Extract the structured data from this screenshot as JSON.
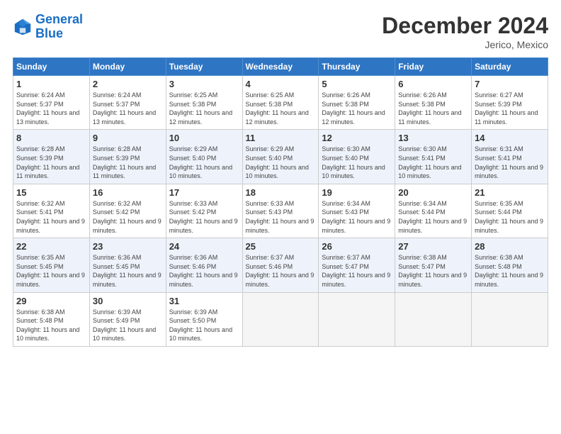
{
  "header": {
    "logo_line1": "General",
    "logo_line2": "Blue",
    "title": "December 2024",
    "subtitle": "Jerico, Mexico"
  },
  "days_of_week": [
    "Sunday",
    "Monday",
    "Tuesday",
    "Wednesday",
    "Thursday",
    "Friday",
    "Saturday"
  ],
  "weeks": [
    [
      {
        "day": "1",
        "sunrise": "Sunrise: 6:24 AM",
        "sunset": "Sunset: 5:37 PM",
        "daylight": "Daylight: 11 hours and 13 minutes."
      },
      {
        "day": "2",
        "sunrise": "Sunrise: 6:24 AM",
        "sunset": "Sunset: 5:37 PM",
        "daylight": "Daylight: 11 hours and 13 minutes."
      },
      {
        "day": "3",
        "sunrise": "Sunrise: 6:25 AM",
        "sunset": "Sunset: 5:38 PM",
        "daylight": "Daylight: 11 hours and 12 minutes."
      },
      {
        "day": "4",
        "sunrise": "Sunrise: 6:25 AM",
        "sunset": "Sunset: 5:38 PM",
        "daylight": "Daylight: 11 hours and 12 minutes."
      },
      {
        "day": "5",
        "sunrise": "Sunrise: 6:26 AM",
        "sunset": "Sunset: 5:38 PM",
        "daylight": "Daylight: 11 hours and 12 minutes."
      },
      {
        "day": "6",
        "sunrise": "Sunrise: 6:26 AM",
        "sunset": "Sunset: 5:38 PM",
        "daylight": "Daylight: 11 hours and 11 minutes."
      },
      {
        "day": "7",
        "sunrise": "Sunrise: 6:27 AM",
        "sunset": "Sunset: 5:39 PM",
        "daylight": "Daylight: 11 hours and 11 minutes."
      }
    ],
    [
      {
        "day": "8",
        "sunrise": "Sunrise: 6:28 AM",
        "sunset": "Sunset: 5:39 PM",
        "daylight": "Daylight: 11 hours and 11 minutes."
      },
      {
        "day": "9",
        "sunrise": "Sunrise: 6:28 AM",
        "sunset": "Sunset: 5:39 PM",
        "daylight": "Daylight: 11 hours and 11 minutes."
      },
      {
        "day": "10",
        "sunrise": "Sunrise: 6:29 AM",
        "sunset": "Sunset: 5:40 PM",
        "daylight": "Daylight: 11 hours and 10 minutes."
      },
      {
        "day": "11",
        "sunrise": "Sunrise: 6:29 AM",
        "sunset": "Sunset: 5:40 PM",
        "daylight": "Daylight: 11 hours and 10 minutes."
      },
      {
        "day": "12",
        "sunrise": "Sunrise: 6:30 AM",
        "sunset": "Sunset: 5:40 PM",
        "daylight": "Daylight: 11 hours and 10 minutes."
      },
      {
        "day": "13",
        "sunrise": "Sunrise: 6:30 AM",
        "sunset": "Sunset: 5:41 PM",
        "daylight": "Daylight: 11 hours and 10 minutes."
      },
      {
        "day": "14",
        "sunrise": "Sunrise: 6:31 AM",
        "sunset": "Sunset: 5:41 PM",
        "daylight": "Daylight: 11 hours and 9 minutes."
      }
    ],
    [
      {
        "day": "15",
        "sunrise": "Sunrise: 6:32 AM",
        "sunset": "Sunset: 5:41 PM",
        "daylight": "Daylight: 11 hours and 9 minutes."
      },
      {
        "day": "16",
        "sunrise": "Sunrise: 6:32 AM",
        "sunset": "Sunset: 5:42 PM",
        "daylight": "Daylight: 11 hours and 9 minutes."
      },
      {
        "day": "17",
        "sunrise": "Sunrise: 6:33 AM",
        "sunset": "Sunset: 5:42 PM",
        "daylight": "Daylight: 11 hours and 9 minutes."
      },
      {
        "day": "18",
        "sunrise": "Sunrise: 6:33 AM",
        "sunset": "Sunset: 5:43 PM",
        "daylight": "Daylight: 11 hours and 9 minutes."
      },
      {
        "day": "19",
        "sunrise": "Sunrise: 6:34 AM",
        "sunset": "Sunset: 5:43 PM",
        "daylight": "Daylight: 11 hours and 9 minutes."
      },
      {
        "day": "20",
        "sunrise": "Sunrise: 6:34 AM",
        "sunset": "Sunset: 5:44 PM",
        "daylight": "Daylight: 11 hours and 9 minutes."
      },
      {
        "day": "21",
        "sunrise": "Sunrise: 6:35 AM",
        "sunset": "Sunset: 5:44 PM",
        "daylight": "Daylight: 11 hours and 9 minutes."
      }
    ],
    [
      {
        "day": "22",
        "sunrise": "Sunrise: 6:35 AM",
        "sunset": "Sunset: 5:45 PM",
        "daylight": "Daylight: 11 hours and 9 minutes."
      },
      {
        "day": "23",
        "sunrise": "Sunrise: 6:36 AM",
        "sunset": "Sunset: 5:45 PM",
        "daylight": "Daylight: 11 hours and 9 minutes."
      },
      {
        "day": "24",
        "sunrise": "Sunrise: 6:36 AM",
        "sunset": "Sunset: 5:46 PM",
        "daylight": "Daylight: 11 hours and 9 minutes."
      },
      {
        "day": "25",
        "sunrise": "Sunrise: 6:37 AM",
        "sunset": "Sunset: 5:46 PM",
        "daylight": "Daylight: 11 hours and 9 minutes."
      },
      {
        "day": "26",
        "sunrise": "Sunrise: 6:37 AM",
        "sunset": "Sunset: 5:47 PM",
        "daylight": "Daylight: 11 hours and 9 minutes."
      },
      {
        "day": "27",
        "sunrise": "Sunrise: 6:38 AM",
        "sunset": "Sunset: 5:47 PM",
        "daylight": "Daylight: 11 hours and 9 minutes."
      },
      {
        "day": "28",
        "sunrise": "Sunrise: 6:38 AM",
        "sunset": "Sunset: 5:48 PM",
        "daylight": "Daylight: 11 hours and 9 minutes."
      }
    ],
    [
      {
        "day": "29",
        "sunrise": "Sunrise: 6:38 AM",
        "sunset": "Sunset: 5:48 PM",
        "daylight": "Daylight: 11 hours and 10 minutes."
      },
      {
        "day": "30",
        "sunrise": "Sunrise: 6:39 AM",
        "sunset": "Sunset: 5:49 PM",
        "daylight": "Daylight: 11 hours and 10 minutes."
      },
      {
        "day": "31",
        "sunrise": "Sunrise: 6:39 AM",
        "sunset": "Sunset: 5:50 PM",
        "daylight": "Daylight: 11 hours and 10 minutes."
      },
      null,
      null,
      null,
      null
    ]
  ]
}
